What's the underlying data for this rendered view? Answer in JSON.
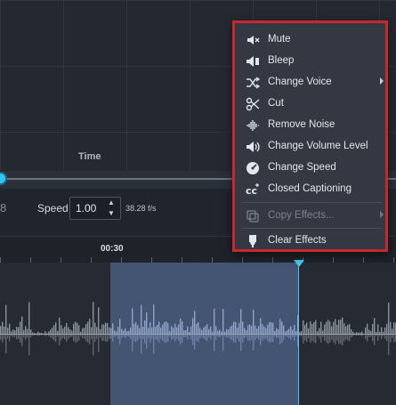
{
  "graph": {
    "axis_label": "Time"
  },
  "controls": {
    "partial_number": "8",
    "speed_label": "Speed",
    "speed_value": "1.00",
    "fps": "38.28 f/s"
  },
  "timeline": {
    "time_label": "00:30"
  },
  "context_menu": {
    "items": [
      {
        "label": "Mute",
        "icon": "speaker-mute-icon",
        "submenu": false,
        "disabled": false
      },
      {
        "label": "Bleep",
        "icon": "speaker-bleep-icon",
        "submenu": false,
        "disabled": false
      },
      {
        "label": "Change Voice",
        "icon": "shuffle-icon",
        "submenu": true,
        "disabled": false
      },
      {
        "label": "Cut",
        "icon": "scissors-icon",
        "submenu": false,
        "disabled": false
      },
      {
        "label": "Remove Noise",
        "icon": "noise-wave-icon",
        "submenu": false,
        "disabled": false
      },
      {
        "label": "Change Volume Level",
        "icon": "speaker-volume-icon",
        "submenu": false,
        "disabled": false
      },
      {
        "label": "Change Speed",
        "icon": "speedometer-icon",
        "submenu": false,
        "disabled": false
      },
      {
        "label": "Closed Captioning",
        "icon": "cc-icon",
        "submenu": false,
        "disabled": false
      },
      {
        "label": "Copy Effects...",
        "icon": "copy-icon",
        "submenu": true,
        "disabled": true
      },
      {
        "label": "Clear Effects",
        "icon": "eraser-icon",
        "submenu": false,
        "disabled": false
      }
    ]
  },
  "colors": {
    "accent": "#34c6f0",
    "menu_border": "#c8282d",
    "selection": "#4a5d80",
    "playhead": "#41cbe8"
  }
}
